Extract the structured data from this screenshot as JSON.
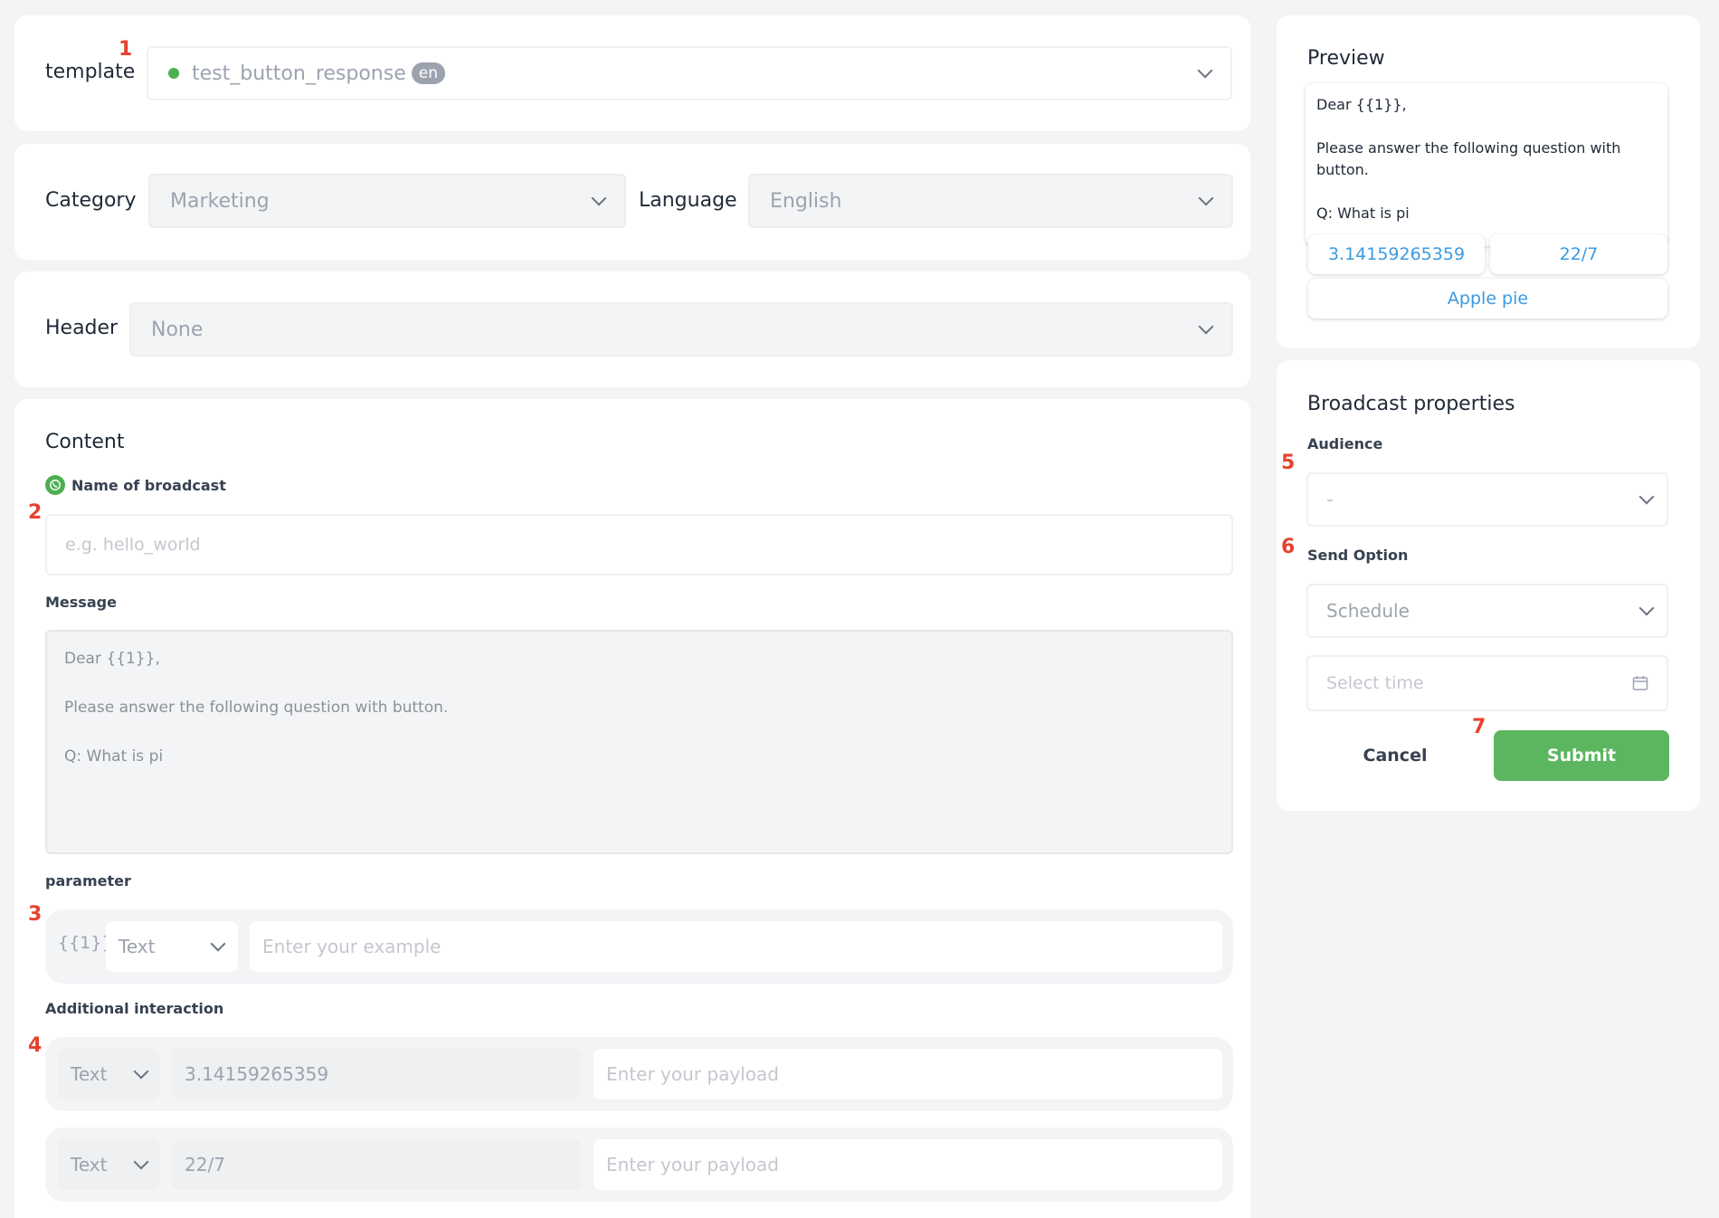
{
  "markers": [
    "1",
    "2",
    "3",
    "4",
    "5",
    "6",
    "7"
  ],
  "template": {
    "label": "template",
    "name": "test_button_response",
    "lang_badge": "en",
    "status_color": "#4caf50"
  },
  "category": {
    "label": "Category",
    "value": "Marketing"
  },
  "language": {
    "label": "Language",
    "value": "English"
  },
  "header": {
    "label": "Header",
    "value": "None"
  },
  "content": {
    "title": "Content",
    "name_label": "Name of broadcast",
    "name_placeholder": "e.g. hello_world",
    "message_label": "Message",
    "message_lines": [
      "Dear {{1}},",
      "Please answer the following question with button.",
      "Q: What is pi"
    ],
    "parameter_label": "parameter",
    "parameter": {
      "token": "{{1}}",
      "type": "Text",
      "placeholder": "Enter your example"
    },
    "additional_label": "Additional interaction",
    "interactions": [
      {
        "type": "Text",
        "value": "3.14159265359",
        "payload_placeholder": "Enter your payload"
      },
      {
        "type": "Text",
        "value": "22/7",
        "payload_placeholder": "Enter your payload"
      }
    ]
  },
  "preview": {
    "title": "Preview",
    "lines": [
      "Dear {{1}},",
      "Please answer the following question with",
      "button.",
      "Q: What is pi"
    ],
    "buttons": [
      "3.14159265359",
      "22/7",
      "Apple pie"
    ]
  },
  "broadcast": {
    "title": "Broadcast properties",
    "audience_label": "Audience",
    "audience_value": "-",
    "send_option_label": "Send Option",
    "send_option_value": "Schedule",
    "time_placeholder": "Select time",
    "cancel_label": "Cancel",
    "submit_label": "Submit",
    "submit_color": "#5cb660"
  }
}
